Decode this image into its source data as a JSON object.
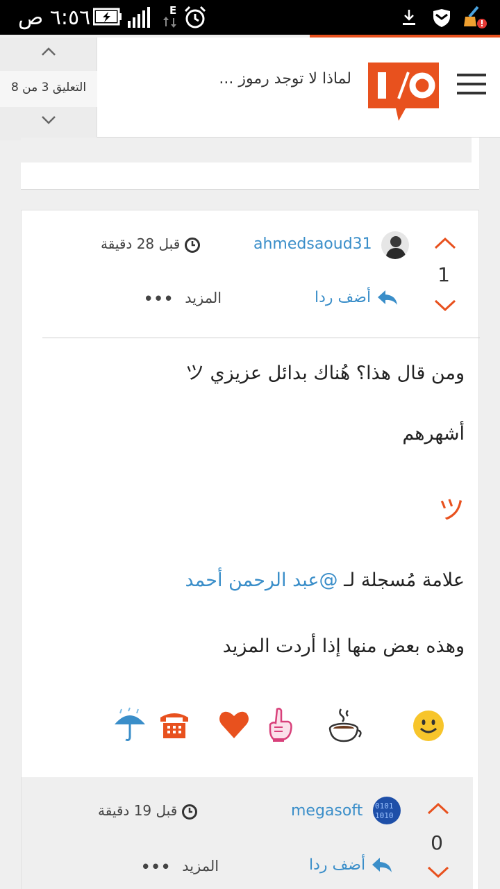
{
  "status_bar": {
    "time": "٦:٥٦ ص",
    "network_label": "E",
    "icons": [
      "battery-charging-icon",
      "signal-icon",
      "alarm-icon",
      "download-icon",
      "shield-icon",
      "cleaner-alert-icon"
    ]
  },
  "header": {
    "title": "لماذا لا توجد رموز ...",
    "logo": "logo-icon",
    "menu_icon": "hamburger-icon"
  },
  "navigator": {
    "position_label": "التعليق 3 من 8"
  },
  "comment": {
    "votes": "1",
    "username": "ahmedsaoud31",
    "time": "قبل 28 دقيقة",
    "reply_label": "أضف ردا",
    "more_label": "المزيد",
    "more_dots": "•••",
    "body": {
      "line1": "ومن قال هذا؟ هُناك بدائل عزيزي ツ",
      "line2": "أشهرهم",
      "symbol": "ツ",
      "mention_prefix": "علامة مُسجلة لـ ",
      "mention": "@عبد الرحمن أحمد",
      "line4": "وهذه بعض منها إذا أردت المزيد"
    },
    "emojis": [
      "smiley-icon",
      "coffee-icon",
      "raised-finger-icon",
      "heart-icon",
      "telephone-icon",
      "umbrella-rain-icon"
    ]
  },
  "reply": {
    "votes": "0",
    "username": "megasoft",
    "time": "قبل 19 دقيقة",
    "reply_label": "أضف ردا",
    "more_label": "المزيد",
    "more_dots": "•••"
  },
  "colors": {
    "accent": "#e8511e",
    "link": "#3a8ec9"
  }
}
